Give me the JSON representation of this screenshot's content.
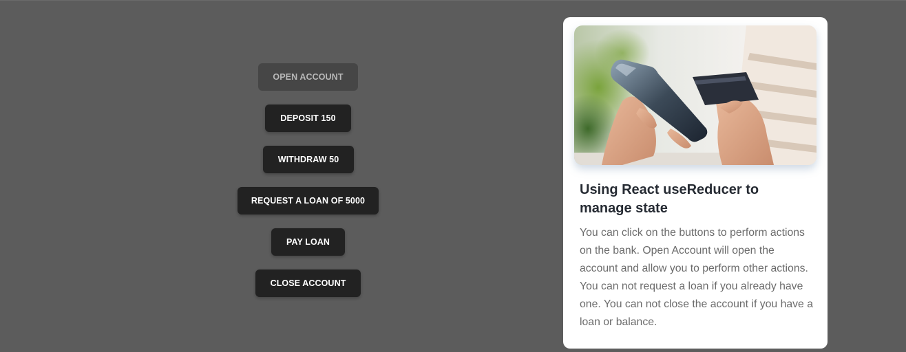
{
  "buttons": {
    "open_account": "OPEN ACCOUNT",
    "deposit": "DEPOSIT 150",
    "withdraw": "WITHDRAW 50",
    "request_loan": "REQUEST A LOAN OF 5000",
    "pay_loan": "PAY LOAN",
    "close_account": "CLOSE ACCOUNT"
  },
  "card": {
    "image_subject": "hand holding smartphone and credit card",
    "title": "Using React useReducer to manage state",
    "description": "You can click on the buttons to perform actions on the bank. Open Account will open the account and allow you to perform other actions. You can not request a loan if you already have one. You can not close the account if you have a loan or balance."
  },
  "colors": {
    "background": "#5c5c5c",
    "button": "#222222",
    "button_disabled": "#464646",
    "card": "#ffffff",
    "title": "#262b33",
    "body_text": "#6b6b6b"
  }
}
